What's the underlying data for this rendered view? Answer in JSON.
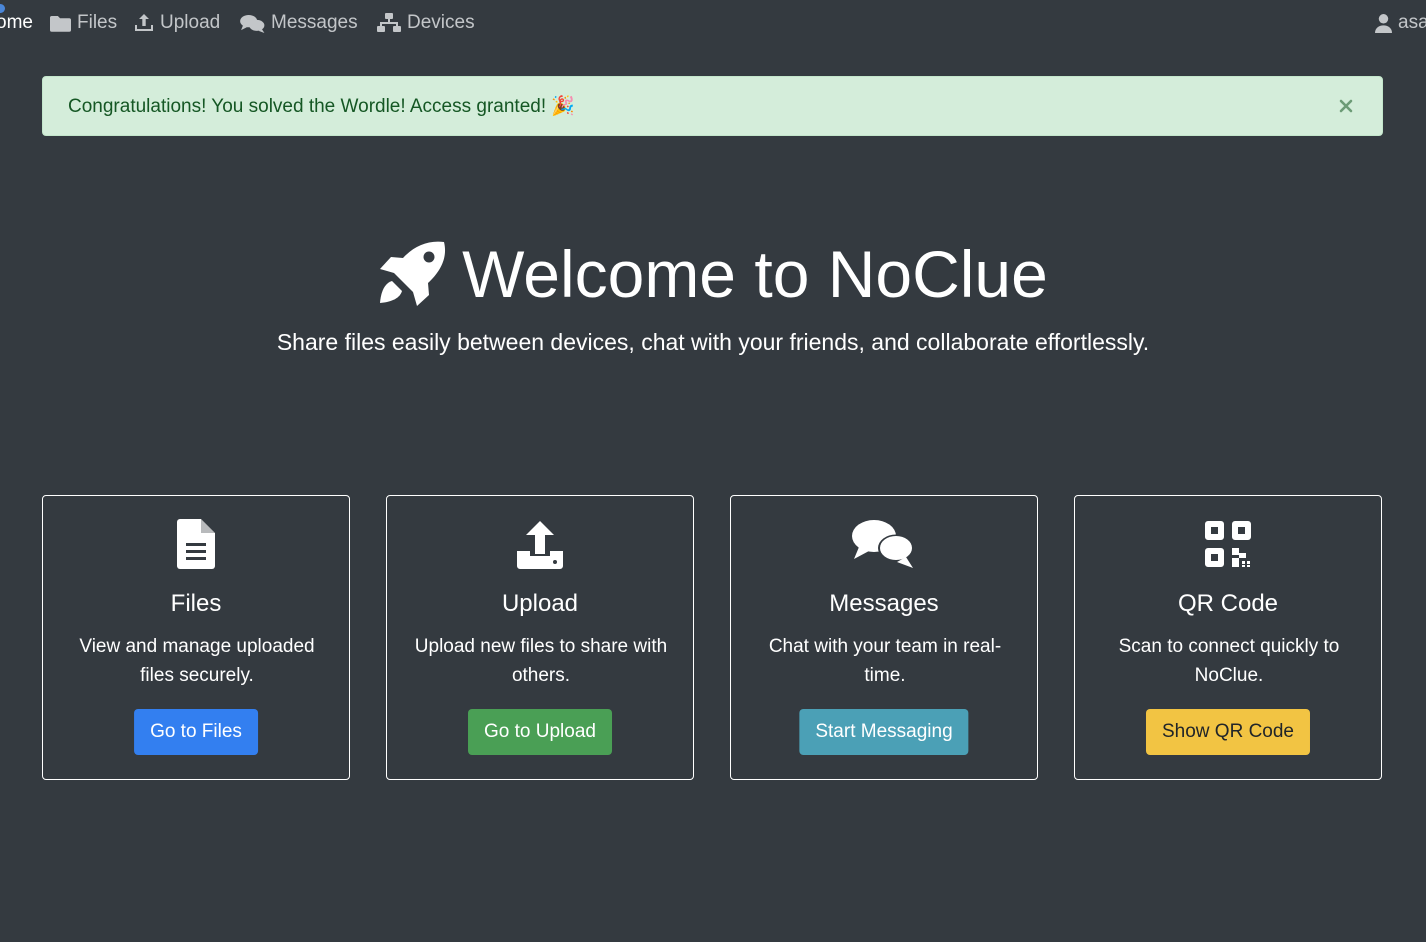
{
  "nav": {
    "home_label": "ome",
    "files_label": "Files",
    "upload_label": "Upload",
    "messages_label": "Messages",
    "devices_label": "Devices",
    "user_label": "asa"
  },
  "alert": {
    "message": "Congratulations! You solved the Wordle! Access granted! 🎉",
    "close_icon": "close-icon"
  },
  "hero": {
    "title": "Welcome to NoClue",
    "subtitle": "Share files easily between devices, chat with your friends, and collaborate effortlessly.",
    "icon": "rocket-icon"
  },
  "cards": [
    {
      "icon": "file-icon",
      "title": "Files",
      "text": "View and manage uploaded files securely.",
      "button": "Go to Files"
    },
    {
      "icon": "upload-icon",
      "title": "Upload",
      "text": "Upload new files to share with others.",
      "button": "Go to Upload"
    },
    {
      "icon": "comments-icon",
      "title": "Messages",
      "text": "Chat with your team in real-time.",
      "button": "Start Messaging"
    },
    {
      "icon": "qrcode-icon",
      "title": "QR Code",
      "text": "Scan to connect quickly to NoClue.",
      "button": "Show QR Code"
    }
  ],
  "colors": {
    "background": "#343a40",
    "alert_bg": "#d4edda",
    "alert_text": "#155724",
    "primary": "#337ff0",
    "success": "#4a9f55",
    "info": "#4ba0b6",
    "warning": "#f2c443"
  }
}
